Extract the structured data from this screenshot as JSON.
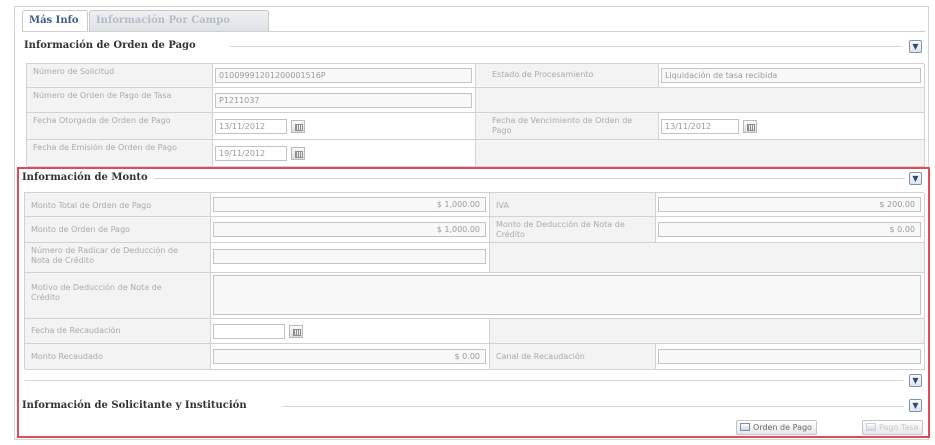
{
  "tabs": [
    {
      "label": "Más Info",
      "active": true
    },
    {
      "label": "Información Por Campo",
      "active": false
    }
  ],
  "sections": {
    "orden_pago": {
      "title": "Información de Orden de Pago"
    },
    "monto": {
      "title": "Información de Monto"
    },
    "solicitante": {
      "title": "Información de Solicitante y Institución"
    }
  },
  "orden_pago": {
    "numero_solicitud": {
      "label": "Número de Solicitud",
      "value": "01009991201200001516P"
    },
    "estado_procesamiento": {
      "label": "Estado de Procesamiento",
      "value": "Liquidación de tasa recibida"
    },
    "numero_orden": {
      "label": "Número de Orden de Pago de Tasa",
      "value": "P1211037"
    },
    "fecha_otorgada": {
      "label": "Fecha Otorgada de Orden de Pago",
      "value": "13/11/2012"
    },
    "fecha_vencimiento": {
      "label": "Fecha de Vencimiento de Orden de Pago",
      "value": "13/11/2012"
    },
    "fecha_emision": {
      "label": "Fecha de Emisión de Orden de Pago",
      "value": "19/11/2012"
    }
  },
  "monto": {
    "monto_total": {
      "label": "Monto Total de Orden de Pago",
      "value": "$ 1,000.00"
    },
    "iva": {
      "label": "IVA",
      "value": "$ 200.00"
    },
    "monto_orden": {
      "label": "Monto de Orden de Pago",
      "value": "$ 1,000.00"
    },
    "monto_deduccion": {
      "label": "Monto de Deducción de Nota de Crédito",
      "value": "$ 0.00"
    },
    "numero_radicar": {
      "label": "Número de Radicar de Deducción de Nota de Crédito",
      "value": ""
    },
    "motivo_deduccion": {
      "label": "Motivo de Deducción de Nota de Crédito",
      "value": ""
    },
    "fecha_recaudacion": {
      "label": "Fecha de Recaudación",
      "value": ""
    },
    "monto_recaudado": {
      "label": "Monto Recaudado",
      "value": "$ 0.00"
    },
    "canal_recaudacion": {
      "label": "Canal de Recaudación",
      "value": ""
    }
  },
  "buttons": {
    "orden_pago": "Orden de Pago",
    "pago_tasa": "Pago Tasa"
  },
  "icons": {
    "collapse": "chevron-down-icon",
    "calendar": "calendar-icon",
    "print": "print-icon"
  },
  "colors": {
    "highlight_border": "#e24a5c",
    "tab_active_text": "#3c5a8a",
    "section_title": "#333333",
    "cell_bg": "#f3f3f3"
  }
}
